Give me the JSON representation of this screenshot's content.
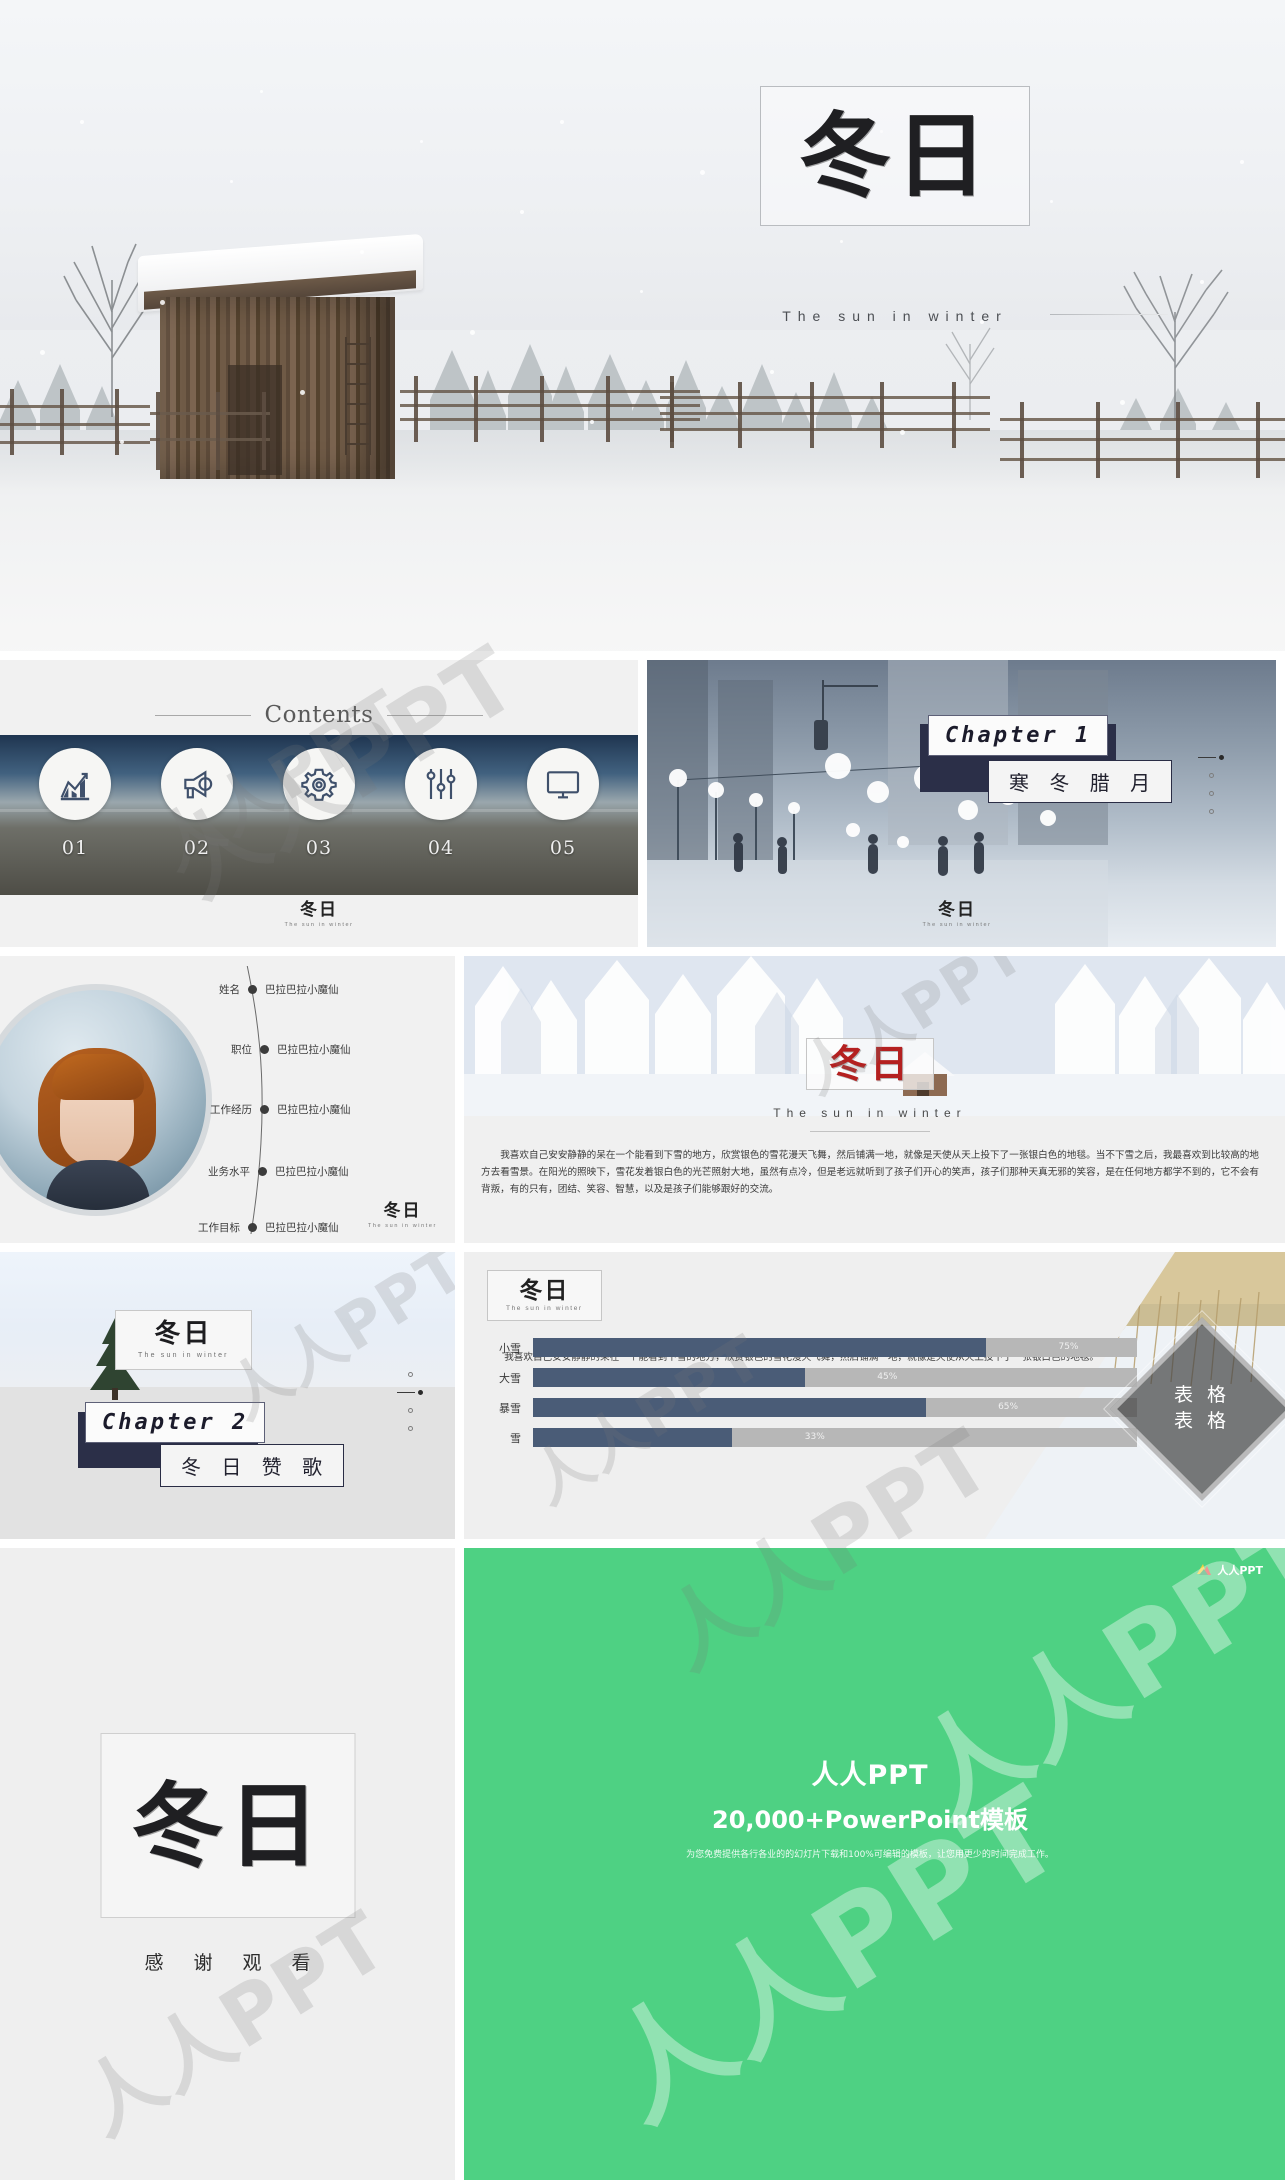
{
  "hero": {
    "title_cn": "冬日",
    "subtitle_en": "The sun in winter"
  },
  "contents": {
    "heading": "Contents",
    "items": [
      {
        "num": "01",
        "icon": "growth-chart-icon"
      },
      {
        "num": "02",
        "icon": "megaphone-icon"
      },
      {
        "num": "03",
        "icon": "gear-icon"
      },
      {
        "num": "04",
        "icon": "sliders-icon"
      },
      {
        "num": "05",
        "icon": "monitor-icon"
      }
    ],
    "logo_cn": "冬日",
    "logo_en": "The sun in winter"
  },
  "chapter1": {
    "en": "Chapter 1",
    "cn": "寒 冬 腊 月",
    "logo_cn": "冬日",
    "logo_en": "The sun in winter"
  },
  "profile": {
    "rows": [
      {
        "label": "姓名",
        "value": "巴拉巴拉小魔仙"
      },
      {
        "label": "职位",
        "value": "巴拉巴拉小魔仙"
      },
      {
        "label": "工作经历",
        "value": "巴拉巴拉小魔仙"
      },
      {
        "label": "业务水平",
        "value": "巴拉巴拉小魔仙"
      },
      {
        "label": "工作目标",
        "value": "巴拉巴拉小魔仙"
      }
    ],
    "logo_cn": "冬日",
    "logo_en": "The sun in winter"
  },
  "winter_text": {
    "title_cn": "冬日",
    "subtitle_en": "The sun in winter",
    "body": "我喜欢自己安安静静的呆在一个能看到下雪的地方，欣赏银色的雪花漫天飞舞，然后铺满一地，就像是天使从天上投下了一张银白色的地毯。当不下雪之后，我最喜欢到比较高的地方去看雪景。在阳光的照映下，雪花发着银白色的光芒照射大地，虽然有点冷，但是老远就听到了孩子们开心的笑声，孩子们那种天真无邪的笑容，是在任何地方都学不到的，它不会有背叛，有的只有，团结、笑容、智慧，以及是孩子们能够跟好的交流。"
  },
  "chapter2": {
    "en": "Chapter 2",
    "cn": "冬 日 赞 歌",
    "logo_cn": "冬日",
    "logo_en": "The sun in winter"
  },
  "chart_slide": {
    "logo_cn": "冬日",
    "logo_en": "The sun in winter",
    "intro": "我喜欢自己安安静静的呆在一个能看到下雪的地方，欣赏银色的雪花漫天飞舞，然后铺满一地，就像是天使从天上投下了一张银白色的地毯。",
    "diamond_line1": "表 格",
    "diamond_line2": "表 格"
  },
  "chart_data": {
    "type": "bar",
    "orientation": "horizontal",
    "categories": [
      "小雪",
      "大雪",
      "暴雪",
      "雪"
    ],
    "values": [
      75,
      45,
      65,
      33
    ],
    "value_labels": [
      "75%",
      "45%",
      "65%",
      "33%"
    ],
    "title": "",
    "xlabel": "",
    "ylabel": "",
    "xlim": [
      0,
      100
    ],
    "grid": false,
    "legend": "none",
    "colors": {
      "fill": "#4a5c77",
      "track": "#b7b7b7",
      "label": "#f0f0f0"
    }
  },
  "thanks": {
    "title_cn": "冬日",
    "message": "感谢观看"
  },
  "promo": {
    "logo_text": "人人PPT",
    "headline": "人人PPT",
    "subhead": "20,000+PowerPoint模板",
    "tagline": "为您免费提供各行各业的的幻灯片下载和100%可编辑的模板，让您用更少的时间完成工作。",
    "bg_color": "#4ed183"
  },
  "watermark": {
    "text": "人人PPT"
  }
}
